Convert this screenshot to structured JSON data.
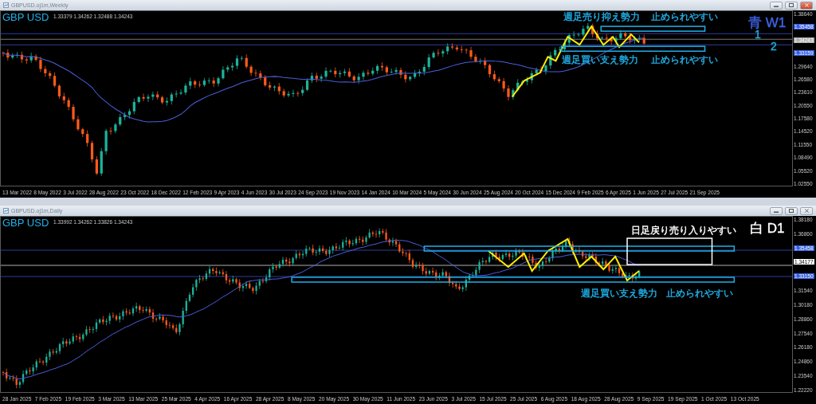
{
  "windows": [
    {
      "title": "GBPUSD.oj1m,Weekly",
      "buttons": [
        {
          "kind": "minimize"
        },
        {
          "kind": "restore"
        },
        {
          "kind": "close"
        }
      ],
      "symbol_label": "GBP USD",
      "ohlc": "1.33379 1.34262 1.32488 1.34243",
      "annotations": [
        {
          "kind": "zone",
          "text": "週足売り抑え勢力",
          "color": "#1fb0e8"
        },
        {
          "kind": "zone",
          "text": "止められやすい",
          "color": "#1fb0e8"
        },
        {
          "kind": "zone",
          "text": "週足買い支え勢力",
          "color": "#1fb0e8"
        },
        {
          "kind": "zone",
          "text": "止められやすい",
          "color": "#1fb0e8"
        },
        {
          "kind": "timeframe",
          "text": "青 W1",
          "color": "#3f63e6"
        },
        {
          "kind": "line_label",
          "text": "1",
          "color": "#1fb0e8"
        },
        {
          "kind": "line_label",
          "text": "2",
          "color": "#1fb0e8"
        }
      ],
      "price_axis": [
        {
          "kind": "tick",
          "text": "1.38640"
        },
        {
          "kind": "marker",
          "text": "1.35458",
          "color": "#3560e0"
        },
        {
          "kind": "marker",
          "text": "1.34243",
          "color": "#b0b0b0"
        },
        {
          "kind": "marker",
          "text": "1.33159",
          "color": "#3560e0"
        },
        {
          "kind": "tick",
          "text": "1.29640"
        },
        {
          "kind": "tick",
          "text": "1.26580"
        },
        {
          "kind": "tick",
          "text": "1.23610"
        },
        {
          "kind": "tick",
          "text": "1.20550"
        },
        {
          "kind": "tick",
          "text": "1.17580"
        },
        {
          "kind": "tick",
          "text": "1.14520"
        },
        {
          "kind": "tick",
          "text": "1.11550"
        },
        {
          "kind": "tick",
          "text": "1.08490"
        },
        {
          "kind": "tick",
          "text": "1.05520"
        },
        {
          "kind": "tick",
          "text": "1.02550"
        }
      ],
      "date_axis": [
        "13 Mar 2022",
        "8 May 2022",
        "3 Jul 2022",
        "28 Aug 2022",
        "23 Oct 2022",
        "18 Dec 2022",
        "12 Feb 2023",
        "9 Apr 2023",
        "4 Jun 2023",
        "30 Jul 2023",
        "24 Sep 2023",
        "19 Nov 2023",
        "14 Jan 2024",
        "10 Mar 2024",
        "5 May 2024",
        "30 Jun 2024",
        "25 Aug 2024",
        "20 Oct 2024",
        "15 Dec 2024",
        "9 Feb 2025",
        "6 Apr 2025",
        "1 Jun 2025",
        "27 Jul 2025",
        "21 Sep 2025"
      ]
    },
    {
      "title": "GBPUSD.oj1m,Daily",
      "buttons": [
        {
          "kind": "minimize"
        },
        {
          "kind": "restore"
        },
        {
          "kind": "close_inactive"
        }
      ],
      "symbol_label": "GBP USD",
      "ohlc": "1.33992 1.34262 1.33826 1.34243",
      "annotations": [
        {
          "kind": "zone",
          "text": "日足戻り売り入りやすい",
          "color": "#ffffff"
        },
        {
          "kind": "timeframe",
          "text": "白 D1",
          "color": "#ffffff"
        },
        {
          "kind": "zone",
          "text": "週足買い支え勢力",
          "color": "#1fb0e8"
        },
        {
          "kind": "zone",
          "text": "止められやすい",
          "color": "#1fb0e8"
        }
      ],
      "price_axis": [
        {
          "kind": "tick",
          "text": "1.38180"
        },
        {
          "kind": "tick",
          "text": "1.36860"
        },
        {
          "kind": "marker",
          "text": "1.35458",
          "color": "#3560e0"
        },
        {
          "kind": "marker",
          "text": "1.34177",
          "color": "#ffffff"
        },
        {
          "kind": "marker",
          "text": "1.33150",
          "color": "#3560e0"
        },
        {
          "kind": "tick",
          "text": "1.31540"
        },
        {
          "kind": "tick",
          "text": "1.30180"
        },
        {
          "kind": "tick",
          "text": "1.28860"
        },
        {
          "kind": "tick",
          "text": "1.27540"
        },
        {
          "kind": "tick",
          "text": "1.26180"
        },
        {
          "kind": "tick",
          "text": "1.24860"
        },
        {
          "kind": "tick",
          "text": "1.23540"
        },
        {
          "kind": "tick",
          "text": "1.22220"
        }
      ],
      "date_axis": [
        "28 Jan 2025",
        "7 Feb 2025",
        "19 Feb 2025",
        "3 Mar 2025",
        "13 Mar 2025",
        "25 Mar 2025",
        "4 Apr 2025",
        "16 Apr 2025",
        "28 Apr 2025",
        "8 May 2025",
        "20 May 2025",
        "30 May 2025",
        "11 Jun 2025",
        "23 Jun 2025",
        "3 Jul 2025",
        "15 Jul 2025",
        "25 Jul 2025",
        "6 Aug 2025",
        "18 Aug 2025",
        "28 Aug 2025",
        "9 Sep 2025",
        "19 Sep 2025",
        "1 Oct 2025",
        "13 Oct 2025"
      ]
    }
  ]
}
